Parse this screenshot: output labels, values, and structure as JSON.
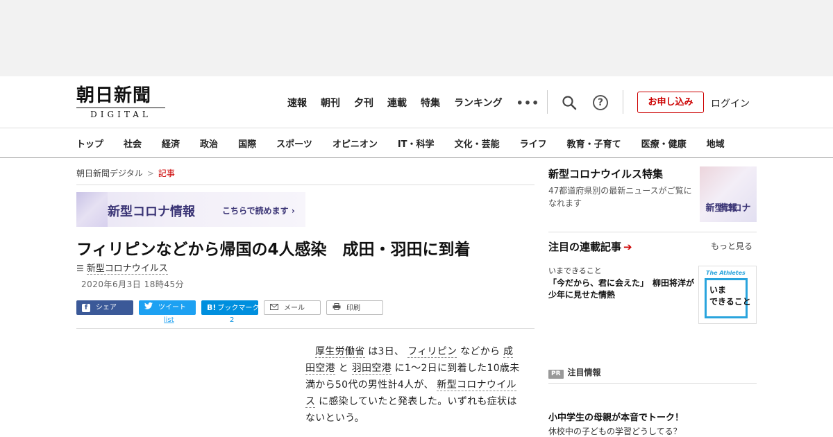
{
  "header": {
    "logo_main": "朝日新聞",
    "logo_sub": "DIGITAL",
    "nav": [
      "速報",
      "朝刊",
      "夕刊",
      "連載",
      "特集",
      "ランキング"
    ],
    "more": "•••",
    "help": "?",
    "apply_label": "お申し込み",
    "login_label": "ログイン"
  },
  "category_nav": [
    "トップ",
    "社会",
    "経済",
    "政治",
    "国際",
    "スポーツ",
    "オピニオン",
    "IT・科学",
    "文化・芸能",
    "ライフ",
    "教育・子育て",
    "医療・健康",
    "地域"
  ],
  "breadcrumb": {
    "home": "朝日新聞デジタル",
    "sep": ">",
    "current": "記事"
  },
  "banner": {
    "title": "新型コロナ情報",
    "link": "こちらで読めます ›"
  },
  "article": {
    "headline": "フィリピンなどから帰国の4人感染　成田・羽田に到着",
    "tag": "新型コロナウイルス",
    "date": "2020年6月3日 18時45分",
    "body": {
      "l1": "厚生労働省",
      "t1": " は3日、 ",
      "l2": "フィリピン",
      "t2": " などから ",
      "l3": "成田空港",
      "t3": " と ",
      "l4": "羽田空港",
      "t4": " に1～2日に到着した10歳未満から50代の男性計4人が、 ",
      "l5": "新型コロナウイルス",
      "t5": " に感染していたと発表した。いずれも症状はないという。"
    }
  },
  "share": {
    "fb_label": "シェア",
    "tw_label": "ツイート",
    "hb_icon": "B!",
    "hb_label": "ブックマーク",
    "mail_label": "メール",
    "print_label": "印刷",
    "tw_count": "list",
    "hb_count": "2"
  },
  "sidebar": {
    "corona": {
      "title": "新型コロナウイルス特集",
      "desc": "47都道府県別の最新ニュースがご覧になれます",
      "thumb_l1": "新型コロナ",
      "thumb_l2": "情報"
    },
    "series": {
      "title": "注目の連載記事",
      "arrow": "➔",
      "more": "もっと見る",
      "kicker": "いまできること",
      "text": "「今だから、君に会えた」　柳田将洋が少年に見せた情熱",
      "thumb_label": "The Athletes",
      "thumb_l1": "いま",
      "thumb_l2": "できること"
    },
    "pr": {
      "badge": "PR",
      "label": "注目情報",
      "title": "小中学生の母親が本音でトーク！",
      "sub": "休校中の子どもの学習どうしてる？"
    }
  },
  "colors": {
    "accent_red": "#cc0000",
    "facebook": "#3b5998",
    "twitter": "#1da1f2",
    "hatena": "#008fde",
    "corona_purple": "#3a3475"
  }
}
